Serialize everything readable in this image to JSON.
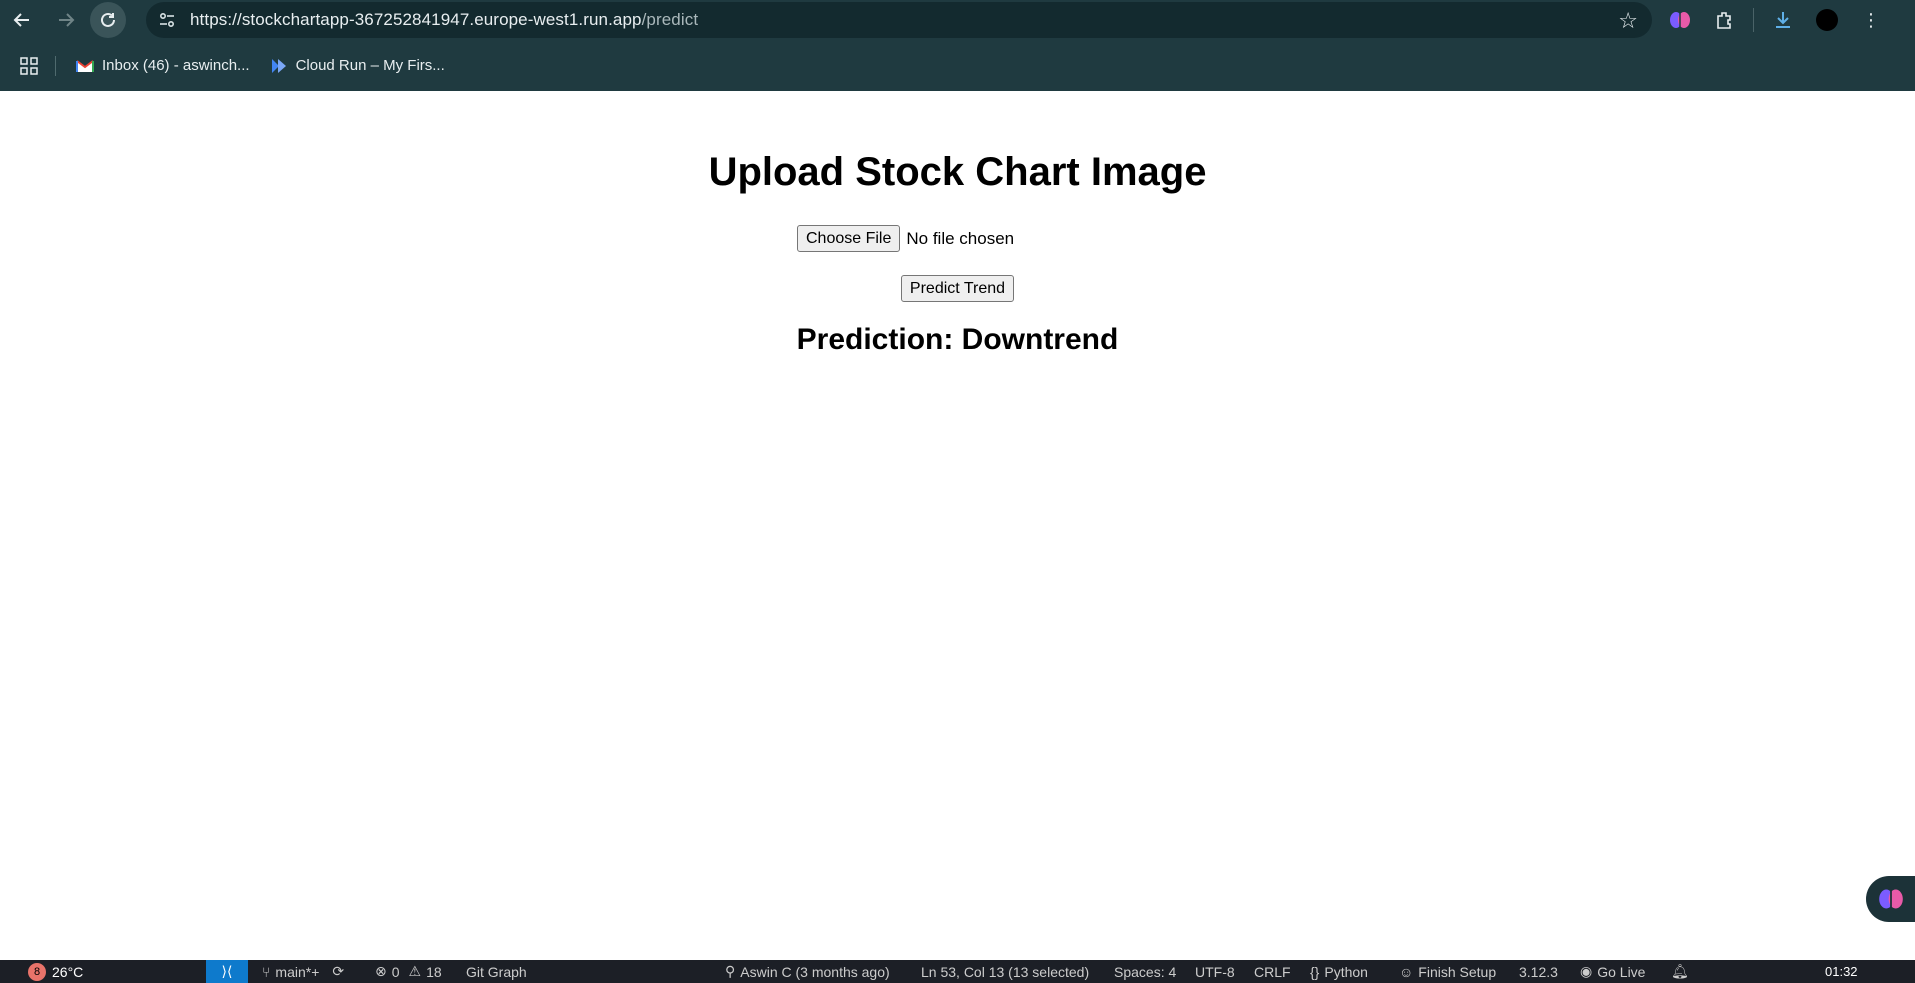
{
  "browser": {
    "url_host": "https://stockchartapp-367252841947.europe-west1.run.app",
    "url_path": "/predict",
    "bookmarks": [
      {
        "label": "Inbox (46) - aswinch...",
        "icon": "gmail-icon"
      },
      {
        "label": "Cloud Run – My Firs...",
        "icon": "cloud-run-icon"
      }
    ]
  },
  "page": {
    "title": "Upload Stock Chart Image",
    "choose_file_label": "Choose File",
    "file_status": "No file chosen",
    "predict_button": "Predict Trend",
    "prediction_text": "Prediction: Downtrend"
  },
  "statusbar": {
    "weather_badge": "8",
    "temperature": "26°C",
    "branch": "main*+",
    "errors": "0",
    "warnings": "18",
    "git_graph": "Git Graph",
    "blame": "Aswin C (3 months ago)",
    "cursor": "Ln 53, Col 13 (13 selected)",
    "spaces": "Spaces: 4",
    "encoding": "UTF-8",
    "eol": "CRLF",
    "language": "Python",
    "finish_setup": "Finish Setup",
    "python_version": "3.12.3",
    "go_live": "Go Live",
    "clock": "01:32"
  },
  "colors": {
    "chrome_bg": "#1f3a40",
    "omnibox_bg": "#132a2f",
    "statusbar_bg": "#1c1f26",
    "remote_accent": "#0e7acc"
  }
}
